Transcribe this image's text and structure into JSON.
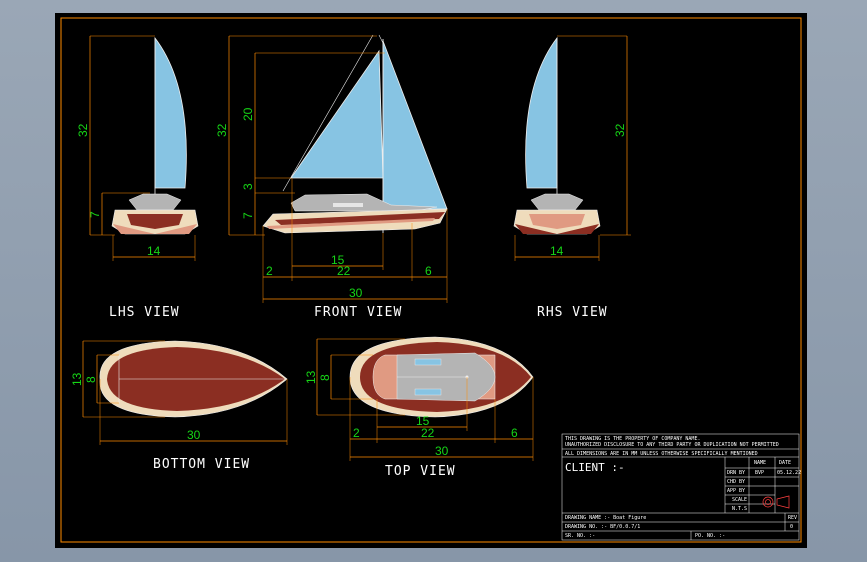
{
  "colors": {
    "background": "#000000",
    "border": "#ff8c00",
    "sail": "#87c4e3",
    "hull_red": "#8b2e22",
    "hull_cream": "#efdcbc",
    "deck_pink": "#e09a82",
    "cabin_gray": "#b4b4b4",
    "dimension": "#16d616",
    "text": "#ffffff"
  },
  "views": {
    "lhs": {
      "label": "LHS  VIEW",
      "dims": {
        "height": "32",
        "hull_height": "7",
        "width": "14"
      }
    },
    "front": {
      "label": "FRONT  VIEW",
      "dims": {
        "height": "32",
        "mast_height": "20",
        "deck_height": "3",
        "hull_height": "7",
        "d15": "15",
        "d2": "2",
        "d22": "22",
        "d6": "6",
        "d30": "30"
      }
    },
    "rhs": {
      "label": "RHS  VIEW",
      "dims": {
        "height": "32",
        "width": "14"
      }
    },
    "bottom": {
      "label": "BOTTOM  VIEW",
      "dims": {
        "width": "13",
        "inner_width": "8",
        "length": "30"
      }
    },
    "top": {
      "label": "TOP  VIEW",
      "dims": {
        "width": "13",
        "inner_width": "8",
        "d15": "15",
        "d2": "2",
        "d22": "22",
        "d6": "6",
        "length": "30"
      }
    }
  },
  "title_block": {
    "notice_1": "THIS DRAWING IS THE PROPERTY OF COMPANY NAME.",
    "notice_2": "UNAUTHORIZED DISCLOSURE TO ANY THIRD PARTY OR DUPLICATION NOT PERMITTED",
    "notice_3": "ALL DIMENSIONS ARE IN MM UNLESS OTHERWISE SPECIFICALLY MENTIONED",
    "client": "CLIENT :-",
    "col_name": "NAME",
    "col_date": "DATE",
    "rows": [
      {
        "label": "DRN BY",
        "name": "BVP",
        "date": "05.12.22"
      },
      {
        "label": "CHD BY",
        "name": "",
        "date": ""
      },
      {
        "label": "APP BY",
        "name": "",
        "date": ""
      },
      {
        "label": "SCALE",
        "name": "",
        "date": ""
      },
      {
        "label": "N.T.S",
        "name": "",
        "date": ""
      }
    ],
    "drawing_name": "DRAWING NAME :- Boat Figure",
    "drawing_no": "DRAWING NO. :- BF/0.0.7/1",
    "rev_label": "REV",
    "rev_value": "0",
    "sr_no": "SR. NO. :-",
    "po_no": "PO. NO. :-"
  }
}
